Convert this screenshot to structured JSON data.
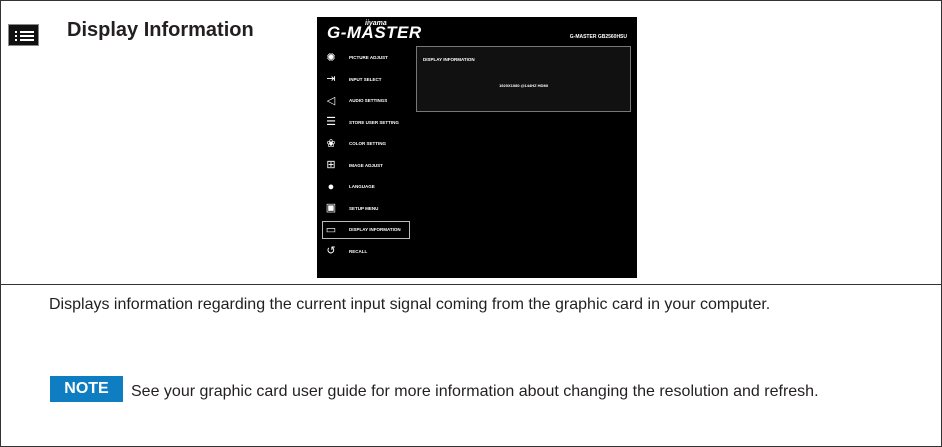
{
  "heading": {
    "title": "Display Information",
    "icon": "info-list-icon"
  },
  "osd": {
    "brand": "iiyama",
    "logo": "G-MASTER",
    "model": "G-MASTER GB2560HSU",
    "menu": [
      {
        "label": "PICTURE ADJUST",
        "icon": "brightness-icon"
      },
      {
        "label": "INPUT SELECT",
        "icon": "input-icon"
      },
      {
        "label": "AUDIO SETTINGS",
        "icon": "speaker-icon"
      },
      {
        "label": "STORE USER SETTING",
        "icon": "sliders-icon"
      },
      {
        "label": "COLOR SETTING",
        "icon": "color-icon"
      },
      {
        "label": "IMAGE ADJUST",
        "icon": "image-adjust-icon"
      },
      {
        "label": "LANGUAGE",
        "icon": "globe-icon"
      },
      {
        "label": "SETUP MENU",
        "icon": "setup-icon"
      },
      {
        "label": "DISPLAY INFORMATION",
        "icon": "display-info-icon"
      },
      {
        "label": "RECALL",
        "icon": "recall-icon"
      }
    ],
    "panel": {
      "title": "DISPLAY INFORMATION",
      "value": "1920X1080 @144HZ HDMI"
    }
  },
  "description": "Displays information regarding the current input signal coming from the graphic card in your computer.",
  "note": {
    "badge": "NOTE",
    "text": "See your graphic card user guide for more information about changing the resolution and refresh."
  }
}
